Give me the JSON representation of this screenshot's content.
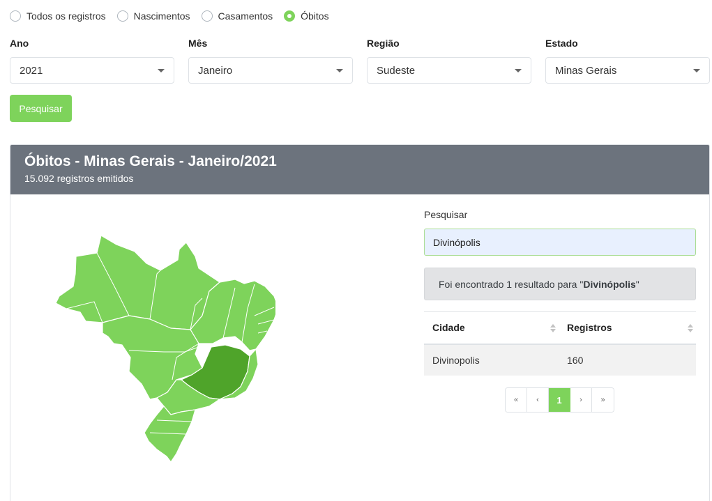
{
  "radios": [
    {
      "label": "Todos os registros",
      "checked": false
    },
    {
      "label": "Nascimentos",
      "checked": false
    },
    {
      "label": "Casamentos",
      "checked": false
    },
    {
      "label": "Óbitos",
      "checked": true
    }
  ],
  "filters": {
    "ano": {
      "label": "Ano",
      "value": "2021"
    },
    "mes": {
      "label": "Mês",
      "value": "Janeiro"
    },
    "regiao": {
      "label": "Região",
      "value": "Sudeste"
    },
    "estado": {
      "label": "Estado",
      "value": "Minas Gerais"
    }
  },
  "search_button": "Pesquisar",
  "card": {
    "title": "Óbitos - Minas Gerais - Janeiro/2021",
    "subtitle": "15.092 registros emitidos"
  },
  "map": {
    "fill_color": "#7ed35b",
    "highlight_color": "#4fa42a",
    "highlighted_state": "Minas Gerais"
  },
  "side": {
    "search_label": "Pesquisar",
    "search_value": "Divinópolis",
    "result_prefix": "Foi encontrado 1 resultado para \"",
    "result_term": "Divinópolis",
    "result_suffix": "\""
  },
  "table": {
    "headers": [
      "Cidade",
      "Registros"
    ],
    "rows": [
      [
        "Divinopolis",
        "160"
      ]
    ]
  },
  "pagination": [
    "«",
    "‹",
    "1",
    "›",
    "»"
  ],
  "colors": {
    "accent": "#7ed35b",
    "header_bg": "#6c737d"
  }
}
